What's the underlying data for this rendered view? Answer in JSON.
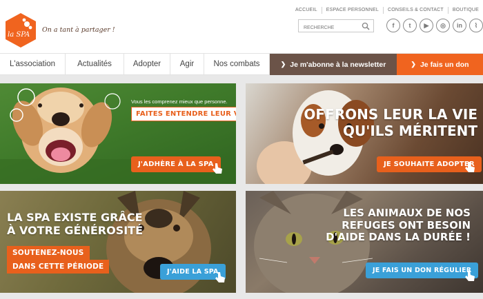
{
  "brand": {
    "logo_text": "la SPA",
    "tagline": "On a tant à partager !",
    "colors": {
      "orange": "#f0641f",
      "brown": "#6b5348",
      "blue": "#3aa0d8",
      "green_bg": "#3f7a2a"
    }
  },
  "top_links": [
    "ACCUEIL",
    "ESPACE PERSONNEL",
    "CONSEILS & CONTACT",
    "BOUTIQUE"
  ],
  "search": {
    "placeholder": "RECHERCHE",
    "value": ""
  },
  "socials": [
    {
      "icon": "facebook-icon",
      "glyph": "f"
    },
    {
      "icon": "twitter-icon",
      "glyph": "t"
    },
    {
      "icon": "youtube-icon",
      "glyph": "▶"
    },
    {
      "icon": "instagram-icon",
      "glyph": "◎"
    },
    {
      "icon": "linkedin-icon",
      "glyph": "in"
    },
    {
      "icon": "rss-icon",
      "glyph": "⌇"
    }
  ],
  "nav": {
    "items": [
      "L'association",
      "Actualités",
      "Adopter",
      "Agir",
      "Nos combats"
    ],
    "newsletter": "Je m'abonne à la newsletter",
    "donate": "Je fais un don"
  },
  "banners": {
    "adhere": {
      "lead": "Vous les comprenez mieux que personne.",
      "callout": "FAITES ENTENDRE LEUR VOIX",
      "cta": "J'ADHÈRE À LA SPA"
    },
    "adopt": {
      "headline": "OFFRONS LEUR LA VIE\nQU'ILS MÉRITENT",
      "cta": "JE SOUHAITE ADOPTER"
    },
    "generosity": {
      "headline": "LA SPA EXISTE GRÂCE\nÀ VOTRE GÉNÉROSITÉ",
      "callout_1": "SOUTENEZ-NOUS",
      "callout_2": "DANS CETTE PÉRIODE",
      "cta": "J'AIDE LA SPA"
    },
    "regular": {
      "headline": "LES ANIMAUX DE NOS\nREFUGES ONT BESOIN\nD'AIDE DANS LA DURÉE !",
      "cta": "JE FAIS UN DON RÉGULIER"
    }
  }
}
